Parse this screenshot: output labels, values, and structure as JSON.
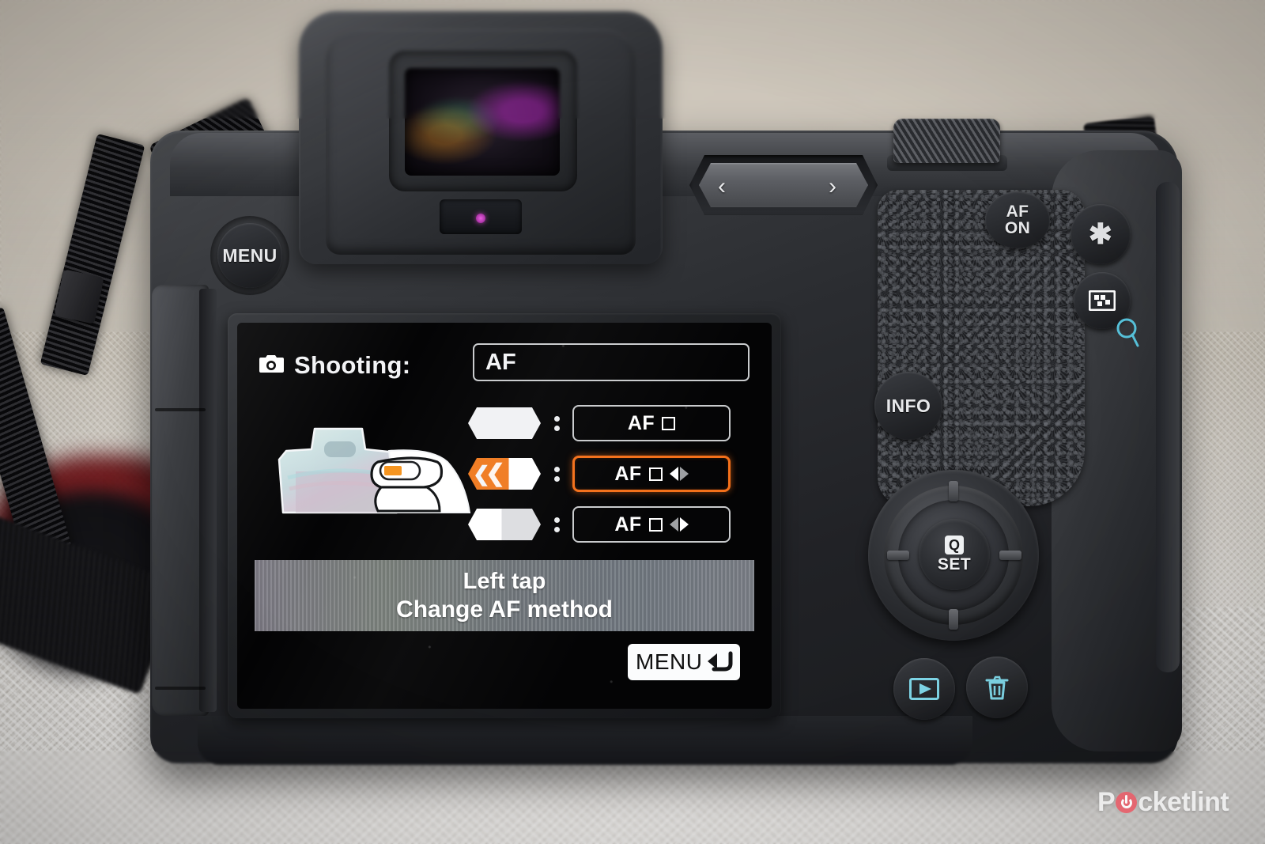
{
  "photo": {
    "subject": "Canon EOS R mirrorless camera rear view",
    "watermark": {
      "text_before": "P",
      "text_after": "cketlint",
      "accent_color": "#e8606b"
    },
    "background_color": "#cfc8bc"
  },
  "camera_controls": {
    "menu_button": "MENU",
    "af_on_line1": "AF",
    "af_on_line2": "ON",
    "ae_lock_icon": "asterisk-icon",
    "af_point_icon": "af-point-select-icon",
    "magnify_icon": "magnify-q-icon",
    "info_button": "INFO",
    "quick_set_q": "Q",
    "quick_set_set": "SET",
    "playback_icon": "playback-icon",
    "delete_icon": "trash-icon",
    "mfn_bar_left_chevron": "‹",
    "mfn_bar_right_chevron": "›",
    "top_dial_icon": "knurled-dial-icon",
    "viewfinder_icon": "electronic-viewfinder",
    "eye_sensor_icon": "eye-sensor-icon",
    "accent_cyan": "#7fd7e8"
  },
  "lcd_screen": {
    "header": {
      "icon": "camera-icon",
      "label": "Shooting:"
    },
    "field": {
      "value": "AF"
    },
    "illustration": "camera-rear-with-thumb-on-mfn-bar",
    "rows": [
      {
        "gesture_icon": "mfn-bar-plain",
        "separator": ":",
        "option": "AF",
        "has_square": true,
        "has_arrows": false,
        "selected": false
      },
      {
        "gesture_icon": "mfn-bar-left-tap-highlighted",
        "separator": ":",
        "option": "AF",
        "has_square": true,
        "has_arrows": true,
        "selected": true
      },
      {
        "gesture_icon": "mfn-bar-right-half",
        "separator": ":",
        "option": "AF",
        "has_square": true,
        "has_arrows": true,
        "selected": false
      }
    ],
    "banner": {
      "line1": "Left tap",
      "line2": "Change AF method"
    },
    "return_badge": {
      "label": "MENU",
      "icon": "return-arrow-icon"
    },
    "selection_color": "#f4701a",
    "screen_background": "#040405"
  }
}
